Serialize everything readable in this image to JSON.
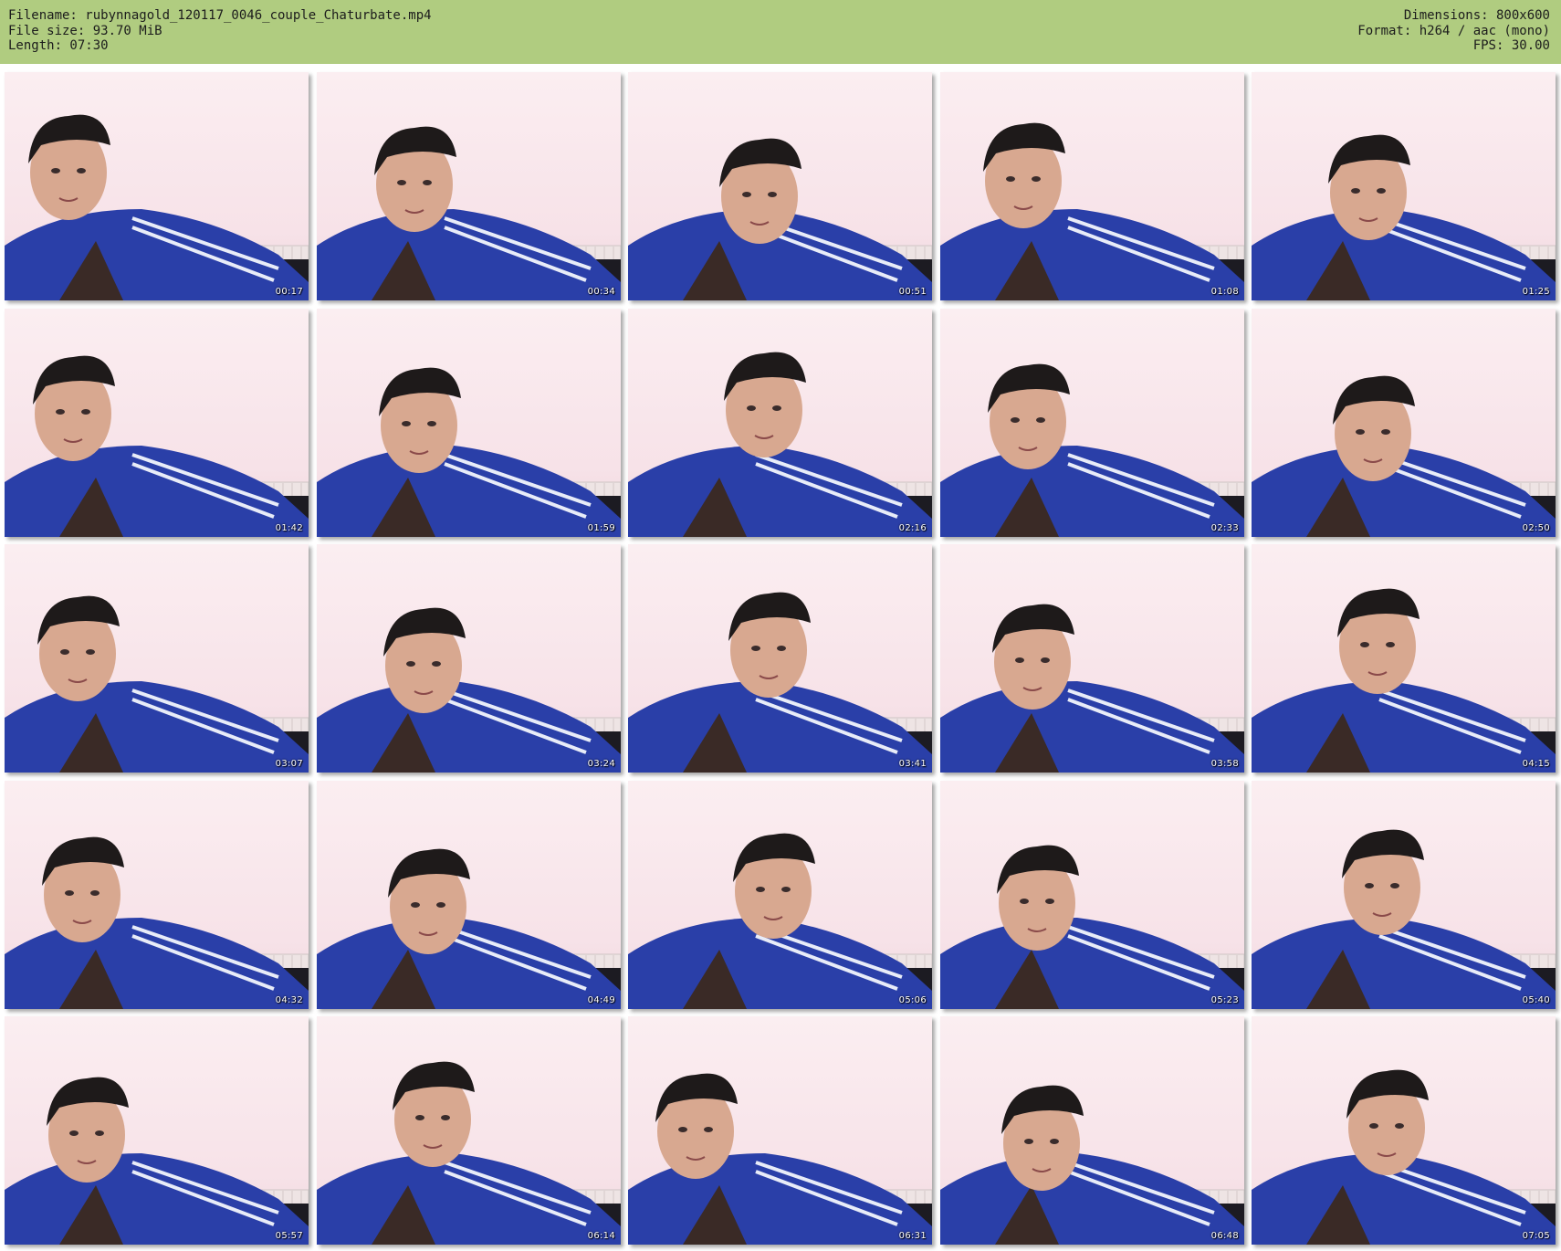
{
  "header": {
    "filename": "Filename: rubynnagold_120117_0046_couple_Chaturbate.mp4",
    "filesize": "File size: 93.70 MiB",
    "length": "Length: 07:30",
    "dimensions": "Dimensions: 800x600",
    "format": "Format: h264 / aac (mono)",
    "fps": "FPS: 30.00"
  },
  "colors": {
    "header_bg": "#b0cc80",
    "jacket_blue": "#2a3fa8",
    "hair": "#1e1a1a",
    "skin": "#d8a890"
  },
  "thumbnails": [
    {
      "time": "00:17"
    },
    {
      "time": "00:34"
    },
    {
      "time": "00:51"
    },
    {
      "time": "01:08"
    },
    {
      "time": "01:25"
    },
    {
      "time": "01:42"
    },
    {
      "time": "01:59"
    },
    {
      "time": "02:16"
    },
    {
      "time": "02:33"
    },
    {
      "time": "02:50"
    },
    {
      "time": "03:07"
    },
    {
      "time": "03:24"
    },
    {
      "time": "03:41"
    },
    {
      "time": "03:58"
    },
    {
      "time": "04:15"
    },
    {
      "time": "04:32"
    },
    {
      "time": "04:49"
    },
    {
      "time": "05:06"
    },
    {
      "time": "05:23"
    },
    {
      "time": "05:40"
    },
    {
      "time": "05:57"
    },
    {
      "time": "06:14"
    },
    {
      "time": "06:31"
    },
    {
      "time": "06:48"
    },
    {
      "time": "07:05"
    }
  ]
}
